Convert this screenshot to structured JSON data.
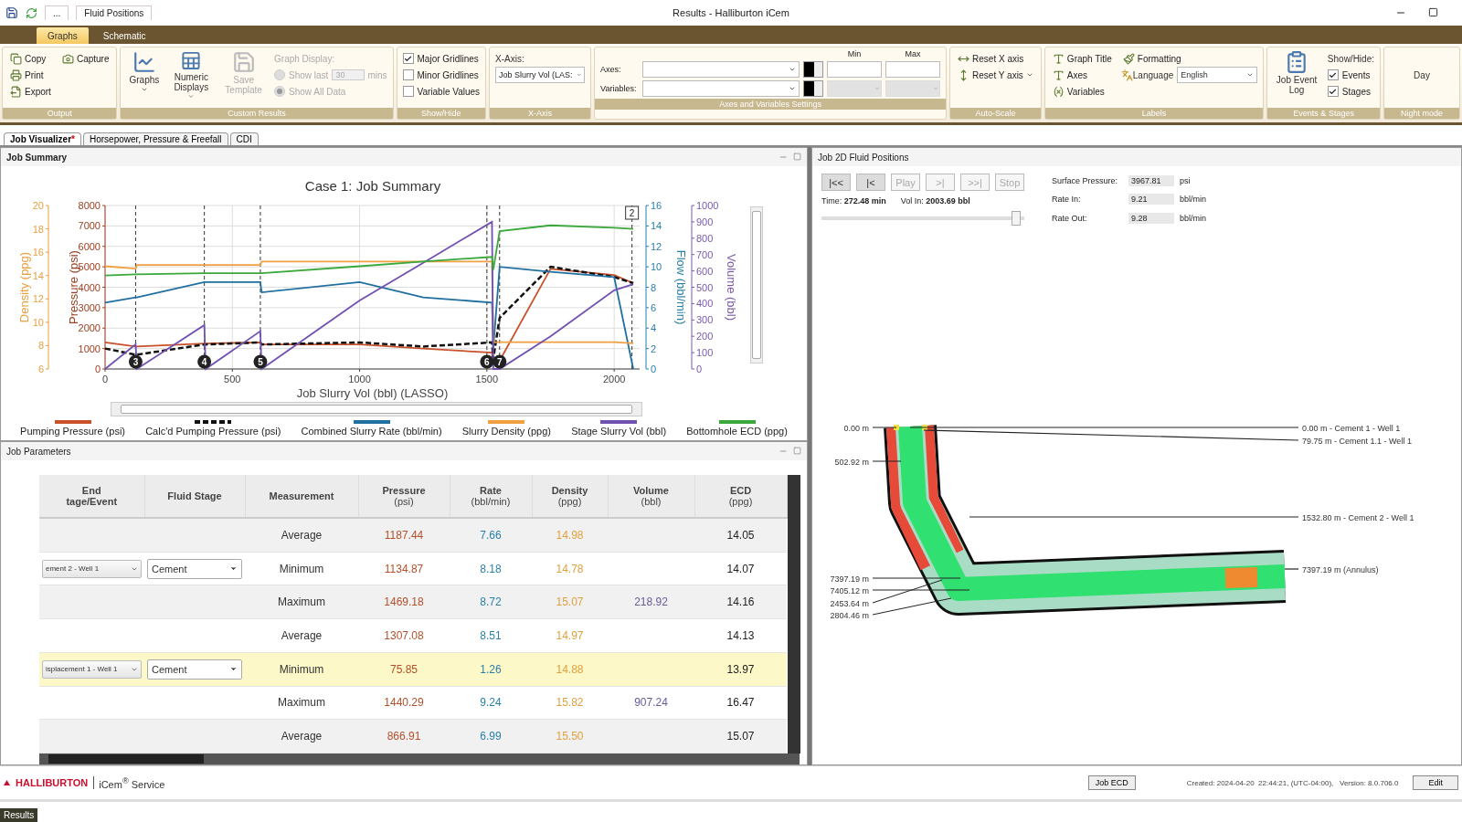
{
  "title_bar": {
    "quick_tab": "Fluid Positions",
    "more": "...",
    "title": "Results - Halliburton iCem"
  },
  "ribbon_tabs": [
    {
      "label": "Graphs",
      "selected": true
    },
    {
      "label": "Schematic",
      "selected": false
    }
  ],
  "ribbon_groups": [
    {
      "title": "Output",
      "kind": "grid",
      "items": [
        {
          "kind": "small",
          "label": "Copy"
        },
        {
          "kind": "small",
          "label": "Print"
        },
        {
          "kind": "small",
          "label": "Export"
        },
        {
          "kind": "small",
          "label": "Capture"
        }
      ]
    },
    {
      "title": "Custom Results",
      "kind": "grid",
      "items": [
        {
          "kind": "large",
          "label": "Graphs",
          "has_menu": true,
          "disabled": false
        },
        {
          "kind": "large",
          "label": "Numeric Displays",
          "has_menu": true,
          "disabled": false
        },
        {
          "kind": "large",
          "label": "Save Template",
          "has_menu": false,
          "disabled": true
        },
        {
          "kind": "text",
          "label": "Graph Display:",
          "disabled": true
        },
        {
          "kind": "spin",
          "label": "Show last",
          "value": "30",
          "unit": "mins",
          "checked": false,
          "disabled": true
        },
        {
          "kind": "radio",
          "label": "Show All Data",
          "checked": true,
          "disabled": true
        }
      ]
    },
    {
      "title": "Show/Hide",
      "kind": "grid",
      "items": [
        {
          "kind": "check",
          "label": "Major Gridlines",
          "checked": true
        },
        {
          "kind": "check",
          "label": "Minor Gridlines",
          "checked": false
        },
        {
          "kind": "check",
          "label": "Variable Values",
          "checked": false
        }
      ]
    },
    {
      "title": "X-Axis",
      "kind": "grid",
      "items": [
        {
          "kind": "text",
          "label": "X-Axis:",
          "disabled": false
        },
        {
          "kind": "select",
          "value": "Job Slurry Vol (LAS:"
        }
      ]
    },
    {
      "title": "Axes and Variables Settings",
      "kind": "axes_settings",
      "columns": [
        "Min",
        "Max"
      ],
      "rows": [
        {
          "label": "Axes:",
          "disabled": false
        },
        {
          "label": "Variables:",
          "disabled": true
        }
      ]
    },
    {
      "title": "Auto-Scale",
      "kind": "grid",
      "items": [
        {
          "kind": "small",
          "label": "Reset X axis",
          "has_menu": false
        },
        {
          "kind": "small",
          "label": "Reset Y axis",
          "has_menu": true
        }
      ]
    },
    {
      "title": "Labels",
      "kind": "grid",
      "items": [
        {
          "kind": "small",
          "label": "Graph Title"
        },
        {
          "kind": "small",
          "label": "Axes"
        },
        {
          "kind": "small",
          "label": "Variables"
        },
        {
          "kind": "small",
          "label": "Formatting"
        },
        {
          "kind": "small_select",
          "label": "Language",
          "value": "English"
        }
      ]
    },
    {
      "title": "Events & Stages",
      "kind": "grid",
      "items": [
        {
          "kind": "large",
          "label": "Job Event Log",
          "has_menu": false,
          "disabled": false
        },
        {
          "kind": "text",
          "label": "Show/Hide:",
          "disabled": false
        },
        {
          "kind": "check",
          "label": "Events",
          "checked": true
        },
        {
          "kind": "check",
          "label": "Stages",
          "checked": true
        }
      ]
    },
    {
      "title": "Night mode",
      "kind": "grid",
      "items": [
        {
          "kind": "plain",
          "label": "Day"
        }
      ]
    }
  ],
  "doc_tabs": [
    {
      "label": "Job Visualizer",
      "marker": "*",
      "selected": true
    },
    {
      "label": "Horsepower, Pressure & Freefall",
      "selected": false
    },
    {
      "label": "CDI",
      "selected": false
    }
  ],
  "job_summary": {
    "title": "Job Summary",
    "chart_data": {
      "type": "line",
      "title": "Case 1: Job Summary",
      "xlabel": "Job Slurry Vol (bbl) (LASSO)",
      "xlim": [
        0,
        2100
      ],
      "xticks": [
        0,
        500,
        1000,
        1500,
        2000
      ],
      "ylabel": "Pressure (psi)",
      "ylim": [
        0,
        8000
      ],
      "yticks": [
        0,
        1000,
        2000,
        3000,
        4000,
        5000,
        6000,
        7000,
        8000
      ],
      "y2label": "Density (ppg)",
      "y2lim": [
        6,
        20
      ],
      "y2ticks": [
        6,
        8,
        10,
        12,
        14,
        16,
        18,
        20
      ],
      "y3label": "Flow (bbl/min)",
      "y3lim": [
        0,
        16
      ],
      "y3ticks": [
        0,
        2,
        4,
        6,
        8,
        10,
        12,
        14,
        16
      ],
      "grid": true,
      "x": [
        0,
        120,
        125,
        390,
        395,
        610,
        615,
        1000,
        1250,
        1520,
        1525,
        1550,
        1750,
        2000,
        2075
      ],
      "series": [
        {
          "name": "Pumping Pressure (psi)",
          "color": "#c8502a",
          "values": [
            1300,
            1100,
            1100,
            1250,
            1250,
            1300,
            1200,
            1200,
            1000,
            800,
            300,
            400,
            4900,
            4600,
            4200
          ]
        },
        {
          "name": "Calc'd Pumping Pressure (psi)",
          "color": "#111111",
          "line_style": "dashed",
          "values": [
            1000,
            700,
            700,
            1200,
            1200,
            1300,
            1200,
            1300,
            1100,
            1300,
            500,
            2500,
            5000,
            4500,
            4200
          ]
        },
        {
          "name": "Combined Slurry Rate (bbl/min)",
          "color": "#1f6fa0",
          "axis": "y3",
          "values": [
            6.5,
            7,
            7,
            8.5,
            8.5,
            8.5,
            7.5,
            8.5,
            7,
            6.5,
            2,
            10,
            9.5,
            9,
            0
          ]
        },
        {
          "name": "Slurry Density (ppg)",
          "color": "#f0a040",
          "axis": "y2",
          "values": [
            14.8,
            14.6,
            14.9,
            14.9,
            14.9,
            14.9,
            15.2,
            15.2,
            15.2,
            15.2,
            8.3,
            8.3,
            8.3,
            8.3,
            8.2
          ]
        },
        {
          "name": "Stage Slurry Vol (bbl)",
          "color": "#7050b0",
          "axis": "y3",
          "values": [
            0,
            2.4,
            0,
            4.3,
            0,
            3.7,
            0,
            6.7,
            10.4,
            14.4,
            0,
            0,
            3.2,
            7.7,
            8.3
          ]
        },
        {
          "name": "Bottomhole ECD (ppg)",
          "color": "#3aa83a",
          "axis": "y2",
          "values": [
            14.0,
            14.1,
            14.1,
            14.2,
            14.2,
            14.2,
            14.2,
            14.8,
            15.2,
            15.6,
            14.5,
            17.8,
            18.3,
            18.1,
            18.0
          ]
        }
      ],
      "annotations": [
        "3",
        "4",
        "5",
        "6",
        "7",
        "2"
      ]
    },
    "volume_axis": {
      "label": "Volume (bbl)",
      "ticks": [
        "1000",
        "900",
        "800",
        "700",
        "600",
        "500",
        "400",
        "300",
        "200",
        "100",
        "0"
      ]
    }
  },
  "job_parameters": {
    "title": "Job Parameters",
    "columns": [
      {
        "title": "End",
        "unit": "tage/Event",
        "kind": "stage_select"
      },
      {
        "title": "Fluid Stage",
        "kind": "fluid_select"
      },
      {
        "title": "Measurement",
        "kind": "text"
      },
      {
        "title": "Pressure",
        "unit": "(psi)",
        "kind": "text",
        "color": "#b0502a"
      },
      {
        "title": "Rate",
        "unit": "(bbl/min)",
        "kind": "text",
        "color": "#2a7fa8"
      },
      {
        "title": "Density",
        "unit": "(ppg)",
        "kind": "text",
        "color": "#e0a040"
      },
      {
        "title": "Volume",
        "unit": "(bbl)",
        "kind": "text",
        "color": "#6a5a9a"
      },
      {
        "title": "ECD",
        "unit": "(ppg)",
        "kind": "text",
        "color": "#222222"
      }
    ],
    "rows": [
      {
        "selected": false,
        "cells": [
          null,
          null,
          "Average",
          "1187.44",
          "7.66",
          "14.98",
          null,
          "14.05"
        ]
      },
      {
        "selected": false,
        "cells": [
          "ement 2 - Well 1",
          "Cement",
          "Minimum",
          "1134.87",
          "8.18",
          "14.78",
          null,
          "14.07"
        ]
      },
      {
        "selected": false,
        "cells": [
          null,
          null,
          "Maximum",
          "1469.18",
          "8.72",
          "15.07",
          "218.92",
          "14.16"
        ]
      },
      {
        "selected": false,
        "cells": [
          null,
          null,
          "Average",
          "1307.08",
          "8.51",
          "14.97",
          null,
          "14.13"
        ]
      },
      {
        "selected": true,
        "cells": [
          "isplacement 1 - Well 1",
          "Cement",
          "Minimum",
          "75.85",
          "1.26",
          "14.88",
          null,
          "13.97"
        ]
      },
      {
        "selected": false,
        "cells": [
          null,
          null,
          "Maximum",
          "1440.29",
          "9.24",
          "15.82",
          "907.24",
          "16.47"
        ]
      },
      {
        "selected": false,
        "cells": [
          null,
          null,
          "Average",
          "866.91",
          "6.99",
          "15.50",
          null,
          "15.07"
        ]
      }
    ]
  },
  "fluid_positions": {
    "title": "Job 2D Fluid Positions",
    "controls": [
      {
        "label": "|<<",
        "disabled": false
      },
      {
        "label": "|<",
        "disabled": false
      },
      {
        "label": "Play",
        "disabled": true
      },
      {
        "label": ">|",
        "disabled": true
      },
      {
        "label": ">>|",
        "disabled": true
      },
      {
        "label": "Stop",
        "disabled": true
      }
    ],
    "time_label": "Time:",
    "time": "272.48 min",
    "vol_label": "Vol In:",
    "vol": "2003.69 bbl",
    "slider": {
      "level": 0.98
    },
    "readouts": [
      {
        "label": "Surface Pressure:",
        "value": "3967.81",
        "unit": "psi"
      },
      {
        "label": "Rate In:",
        "value": "9.21",
        "unit": "bbl/min"
      },
      {
        "label": "Rate Out:",
        "value": "9.28",
        "unit": "bbl/min"
      }
    ],
    "depth_labels": [
      "0.00 m",
      "502.92 m",
      "7397.19 m",
      "7405.12 m",
      "2453.64 m",
      "2804.46 m"
    ],
    "fluid_labels": [
      "0.00 m - Cement 1 - Well 1",
      "79.75 m - Cement 1.1 - Well 1",
      "1532.80 m - Cement 2 - Well 1",
      "7397.19 m (Annulus)"
    ]
  },
  "footer": {
    "brand": "HALLIBURTON",
    "service": "iCem$^{®}$ Service",
    "button": "Job ECD",
    "info": "Created: 2024-04-20  22:44:21, (UTC-04:00),   Version: 8.0.706.0",
    "edit": "Edit"
  },
  "status_bar": {
    "tab": "Results"
  }
}
